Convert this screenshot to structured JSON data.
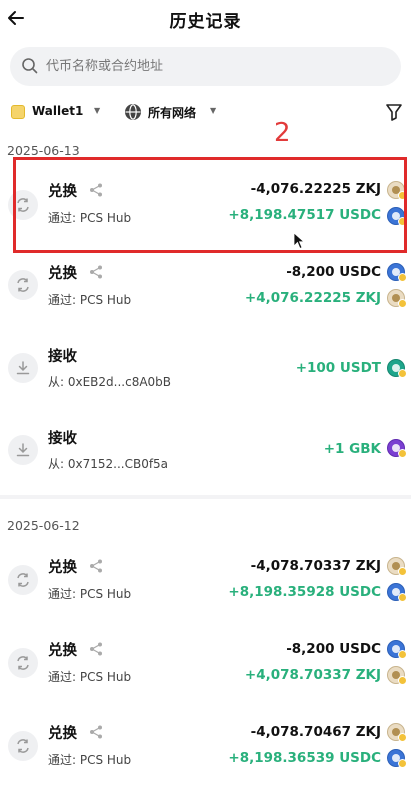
{
  "header": {
    "back_icon": "back-arrow-icon",
    "title": "历史记录"
  },
  "search": {
    "placeholder": "代币名称或合约地址",
    "icon": "search-icon"
  },
  "filters": {
    "wallet_label": "Wallet1",
    "network_label": "所有网络",
    "filter_icon": "filter-icon"
  },
  "annotation": {
    "number": "2",
    "color": "#e02a2a"
  },
  "groups": [
    {
      "date": "2025-06-13",
      "transactions": [
        {
          "type": "兑换",
          "subtitle": "通过: PCS Hub",
          "amount1": "-4,076.22225 ZKJ",
          "coin1": "zkj",
          "amount2": "+8,198.47517 USDC",
          "coin2": "usdc"
        },
        {
          "type": "兑换",
          "subtitle": "通过: PCS Hub",
          "amount1": "-8,200 USDC",
          "coin1": "usdc",
          "amount2": "+4,076.22225 ZKJ",
          "coin2": "zkj"
        },
        {
          "type": "接收",
          "subtitle": "从: 0xEB2d...c8A0bB",
          "amount1": "+100 USDT",
          "coin1": "usdt"
        },
        {
          "type": "接收",
          "subtitle": "从: 0x7152...CB0f5a",
          "amount1": "+1 GBK",
          "coin1": "gbk"
        }
      ]
    },
    {
      "date": "2025-06-12",
      "transactions": [
        {
          "type": "兑换",
          "subtitle": "通过: PCS Hub",
          "amount1": "-4,078.70337 ZKJ",
          "coin1": "zkj",
          "amount2": "+8,198.35928 USDC",
          "coin2": "usdc"
        },
        {
          "type": "兑换",
          "subtitle": "通过: PCS Hub",
          "amount1": "-8,200 USDC",
          "coin1": "usdc",
          "amount2": "+4,078.70337 ZKJ",
          "coin2": "zkj"
        },
        {
          "type": "兑换",
          "subtitle": "通过: PCS Hub",
          "amount1": "-4,078.70467 ZKJ",
          "coin1": "zkj",
          "amount2": "+8,198.36539 USDC",
          "coin2": "usdc"
        }
      ]
    }
  ],
  "colors": {
    "positive": "#29b07c",
    "negative": "#111111",
    "search_bg": "#f1f2f4"
  }
}
